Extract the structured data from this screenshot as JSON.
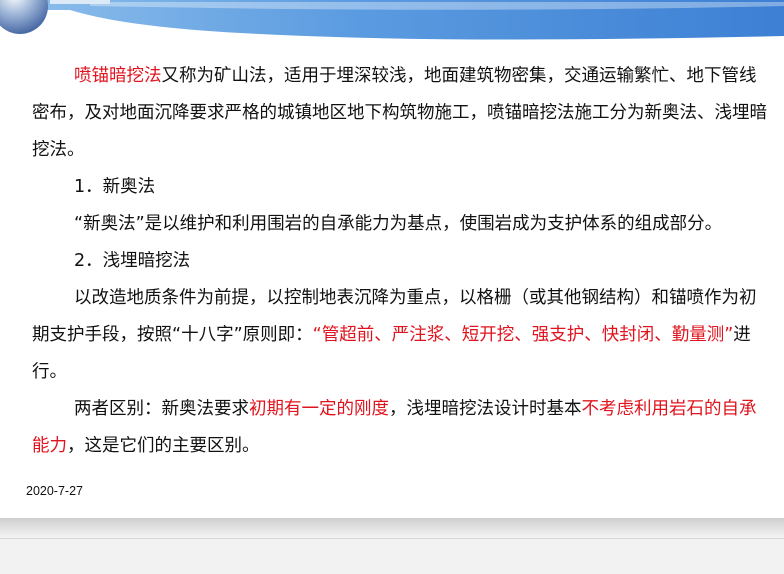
{
  "slide": {
    "p1": [
      {
        "text": "喷锚暗挖法",
        "color": "#e0141e"
      },
      {
        "text": "又称为矿山法，适用于埋深较浅，地面建筑物密集，交通运输繁忙、地下管线密布，及对地面沉降要求严格的城镇地区地下构筑物施工，喷锚暗挖法施工分为新奥法、浅埋暗挖法。"
      }
    ],
    "h1": "1．新奥法",
    "p2": "“新奥法”是以维护和利用围岩的自承能力为基点，使围岩成为支护体系的组成部分。",
    "h2": "2．浅埋暗挖法",
    "p3": [
      {
        "text": "以改造地质条件为前提，以控制地表沉降为重点，以格栅（或其他钢结构）和锚喷作为初期支护手段，按照“十八字”原则即："
      },
      {
        "text": "“管超前、严注浆、短开挖、强支护、快封闭、勤量测”",
        "color": "#e0141e"
      },
      {
        "text": "进行。"
      }
    ],
    "p4": [
      {
        "text": "两者区别：新奥法要求"
      },
      {
        "text": "初期有一定的刚度",
        "color": "#e0141e"
      },
      {
        "text": "，浅埋暗挖法设计时基本"
      },
      {
        "text": "不考虑利用岩石的自承能力",
        "color": "#e0141e"
      },
      {
        "text": "，这是它们的主要区别。"
      }
    ]
  },
  "footer": {
    "date": "2020-7-27"
  },
  "colors": {
    "accent_red": "#e0141e",
    "banner_blue": "#3d80d4"
  }
}
